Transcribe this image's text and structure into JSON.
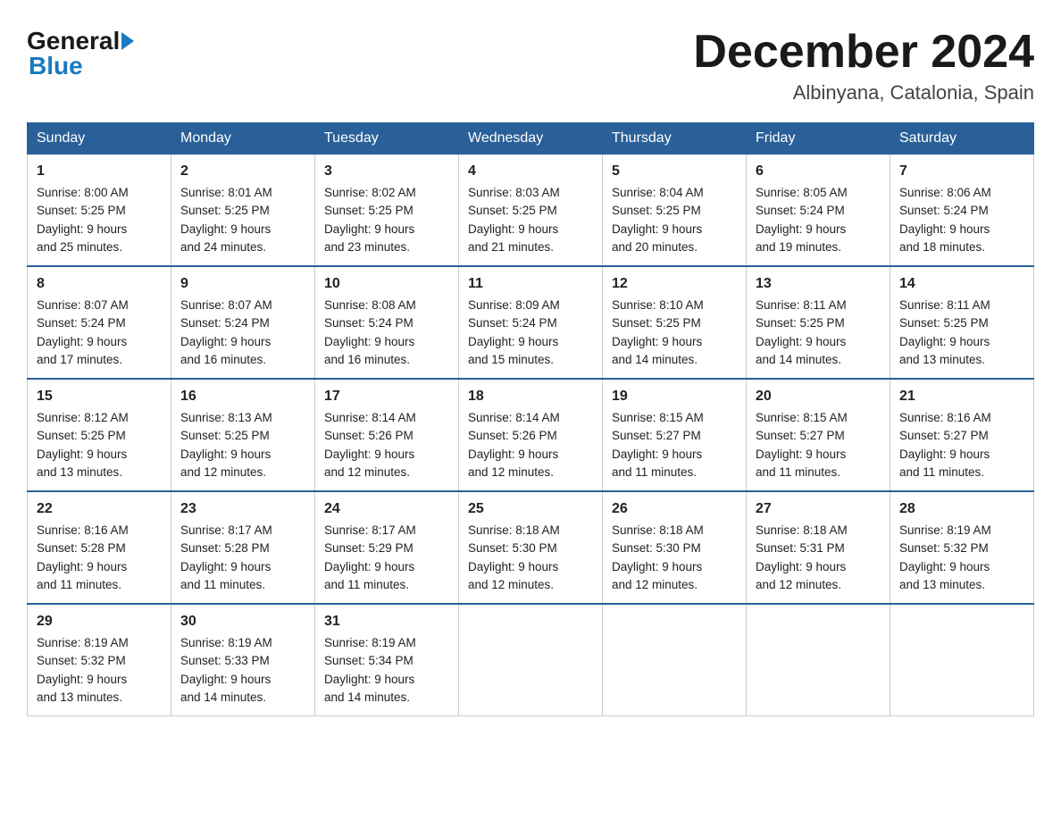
{
  "logo": {
    "general": "General",
    "blue": "Blue"
  },
  "title": "December 2024",
  "location": "Albinyana, Catalonia, Spain",
  "days_header": [
    "Sunday",
    "Monday",
    "Tuesday",
    "Wednesday",
    "Thursday",
    "Friday",
    "Saturday"
  ],
  "weeks": [
    [
      {
        "day": "1",
        "lines": [
          "Sunrise: 8:00 AM",
          "Sunset: 5:25 PM",
          "Daylight: 9 hours",
          "and 25 minutes."
        ]
      },
      {
        "day": "2",
        "lines": [
          "Sunrise: 8:01 AM",
          "Sunset: 5:25 PM",
          "Daylight: 9 hours",
          "and 24 minutes."
        ]
      },
      {
        "day": "3",
        "lines": [
          "Sunrise: 8:02 AM",
          "Sunset: 5:25 PM",
          "Daylight: 9 hours",
          "and 23 minutes."
        ]
      },
      {
        "day": "4",
        "lines": [
          "Sunrise: 8:03 AM",
          "Sunset: 5:25 PM",
          "Daylight: 9 hours",
          "and 21 minutes."
        ]
      },
      {
        "day": "5",
        "lines": [
          "Sunrise: 8:04 AM",
          "Sunset: 5:25 PM",
          "Daylight: 9 hours",
          "and 20 minutes."
        ]
      },
      {
        "day": "6",
        "lines": [
          "Sunrise: 8:05 AM",
          "Sunset: 5:24 PM",
          "Daylight: 9 hours",
          "and 19 minutes."
        ]
      },
      {
        "day": "7",
        "lines": [
          "Sunrise: 8:06 AM",
          "Sunset: 5:24 PM",
          "Daylight: 9 hours",
          "and 18 minutes."
        ]
      }
    ],
    [
      {
        "day": "8",
        "lines": [
          "Sunrise: 8:07 AM",
          "Sunset: 5:24 PM",
          "Daylight: 9 hours",
          "and 17 minutes."
        ]
      },
      {
        "day": "9",
        "lines": [
          "Sunrise: 8:07 AM",
          "Sunset: 5:24 PM",
          "Daylight: 9 hours",
          "and 16 minutes."
        ]
      },
      {
        "day": "10",
        "lines": [
          "Sunrise: 8:08 AM",
          "Sunset: 5:24 PM",
          "Daylight: 9 hours",
          "and 16 minutes."
        ]
      },
      {
        "day": "11",
        "lines": [
          "Sunrise: 8:09 AM",
          "Sunset: 5:24 PM",
          "Daylight: 9 hours",
          "and 15 minutes."
        ]
      },
      {
        "day": "12",
        "lines": [
          "Sunrise: 8:10 AM",
          "Sunset: 5:25 PM",
          "Daylight: 9 hours",
          "and 14 minutes."
        ]
      },
      {
        "day": "13",
        "lines": [
          "Sunrise: 8:11 AM",
          "Sunset: 5:25 PM",
          "Daylight: 9 hours",
          "and 14 minutes."
        ]
      },
      {
        "day": "14",
        "lines": [
          "Sunrise: 8:11 AM",
          "Sunset: 5:25 PM",
          "Daylight: 9 hours",
          "and 13 minutes."
        ]
      }
    ],
    [
      {
        "day": "15",
        "lines": [
          "Sunrise: 8:12 AM",
          "Sunset: 5:25 PM",
          "Daylight: 9 hours",
          "and 13 minutes."
        ]
      },
      {
        "day": "16",
        "lines": [
          "Sunrise: 8:13 AM",
          "Sunset: 5:25 PM",
          "Daylight: 9 hours",
          "and 12 minutes."
        ]
      },
      {
        "day": "17",
        "lines": [
          "Sunrise: 8:14 AM",
          "Sunset: 5:26 PM",
          "Daylight: 9 hours",
          "and 12 minutes."
        ]
      },
      {
        "day": "18",
        "lines": [
          "Sunrise: 8:14 AM",
          "Sunset: 5:26 PM",
          "Daylight: 9 hours",
          "and 12 minutes."
        ]
      },
      {
        "day": "19",
        "lines": [
          "Sunrise: 8:15 AM",
          "Sunset: 5:27 PM",
          "Daylight: 9 hours",
          "and 11 minutes."
        ]
      },
      {
        "day": "20",
        "lines": [
          "Sunrise: 8:15 AM",
          "Sunset: 5:27 PM",
          "Daylight: 9 hours",
          "and 11 minutes."
        ]
      },
      {
        "day": "21",
        "lines": [
          "Sunrise: 8:16 AM",
          "Sunset: 5:27 PM",
          "Daylight: 9 hours",
          "and 11 minutes."
        ]
      }
    ],
    [
      {
        "day": "22",
        "lines": [
          "Sunrise: 8:16 AM",
          "Sunset: 5:28 PM",
          "Daylight: 9 hours",
          "and 11 minutes."
        ]
      },
      {
        "day": "23",
        "lines": [
          "Sunrise: 8:17 AM",
          "Sunset: 5:28 PM",
          "Daylight: 9 hours",
          "and 11 minutes."
        ]
      },
      {
        "day": "24",
        "lines": [
          "Sunrise: 8:17 AM",
          "Sunset: 5:29 PM",
          "Daylight: 9 hours",
          "and 11 minutes."
        ]
      },
      {
        "day": "25",
        "lines": [
          "Sunrise: 8:18 AM",
          "Sunset: 5:30 PM",
          "Daylight: 9 hours",
          "and 12 minutes."
        ]
      },
      {
        "day": "26",
        "lines": [
          "Sunrise: 8:18 AM",
          "Sunset: 5:30 PM",
          "Daylight: 9 hours",
          "and 12 minutes."
        ]
      },
      {
        "day": "27",
        "lines": [
          "Sunrise: 8:18 AM",
          "Sunset: 5:31 PM",
          "Daylight: 9 hours",
          "and 12 minutes."
        ]
      },
      {
        "day": "28",
        "lines": [
          "Sunrise: 8:19 AM",
          "Sunset: 5:32 PM",
          "Daylight: 9 hours",
          "and 13 minutes."
        ]
      }
    ],
    [
      {
        "day": "29",
        "lines": [
          "Sunrise: 8:19 AM",
          "Sunset: 5:32 PM",
          "Daylight: 9 hours",
          "and 13 minutes."
        ]
      },
      {
        "day": "30",
        "lines": [
          "Sunrise: 8:19 AM",
          "Sunset: 5:33 PM",
          "Daylight: 9 hours",
          "and 14 minutes."
        ]
      },
      {
        "day": "31",
        "lines": [
          "Sunrise: 8:19 AM",
          "Sunset: 5:34 PM",
          "Daylight: 9 hours",
          "and 14 minutes."
        ]
      },
      null,
      null,
      null,
      null
    ]
  ]
}
